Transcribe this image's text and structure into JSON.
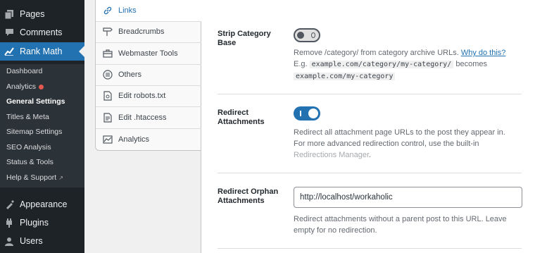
{
  "sidebar": {
    "menu": [
      {
        "label": "Pages",
        "icon": "pages-icon"
      },
      {
        "label": "Comments",
        "icon": "comments-icon"
      },
      {
        "label": "Rank Math",
        "icon": "rank-math-icon"
      },
      {
        "label": "Appearance",
        "icon": "appearance-icon"
      },
      {
        "label": "Plugins",
        "icon": "plugins-icon"
      },
      {
        "label": "Users",
        "icon": "users-icon"
      }
    ],
    "submenu": [
      {
        "label": "Dashboard"
      },
      {
        "label": "Analytics"
      },
      {
        "label": "General Settings"
      },
      {
        "label": "Titles & Meta"
      },
      {
        "label": "Sitemap Settings"
      },
      {
        "label": "SEO Analysis"
      },
      {
        "label": "Status & Tools"
      },
      {
        "label": "Help & Support"
      }
    ]
  },
  "tabs": [
    {
      "label": "Links",
      "icon": "link-icon"
    },
    {
      "label": "Breadcrumbs",
      "icon": "signpost-icon"
    },
    {
      "label": "Webmaster Tools",
      "icon": "toolbox-icon"
    },
    {
      "label": "Others",
      "icon": "list-circle-icon"
    },
    {
      "label": "Edit robots.txt",
      "icon": "file-robot-icon"
    },
    {
      "label": "Edit .htaccess",
      "icon": "file-text-icon"
    },
    {
      "label": "Analytics",
      "icon": "chart-icon"
    }
  ],
  "settings": {
    "strip_category": {
      "label": "Strip Category Base",
      "enabled": false,
      "desc": "Remove /category/ from category archive URLs.",
      "link": "Why do this?",
      "eg": "E.g.",
      "code1": "example.com/category/my-category/",
      "becomes": "becomes",
      "code2": "example.com/my-category"
    },
    "redirect_attachments": {
      "label": "Redirect Attachments",
      "enabled": true,
      "desc": "Redirect all attachment page URLs to the post they appear in. For more advanced redirection control, use the built-in",
      "link": "Redirections Manager",
      "after": "."
    },
    "redirect_orphan": {
      "label": "Redirect Orphan Attachments",
      "value": "http://localhost/workaholic",
      "desc": "Redirect attachments without a parent post to this URL. Leave empty for no redirection."
    }
  },
  "colors": {
    "accent": "#2271b1",
    "sidebar_bg": "#1d2327",
    "submenu_bg": "#2c3338",
    "notification_dot": "#e35950"
  }
}
